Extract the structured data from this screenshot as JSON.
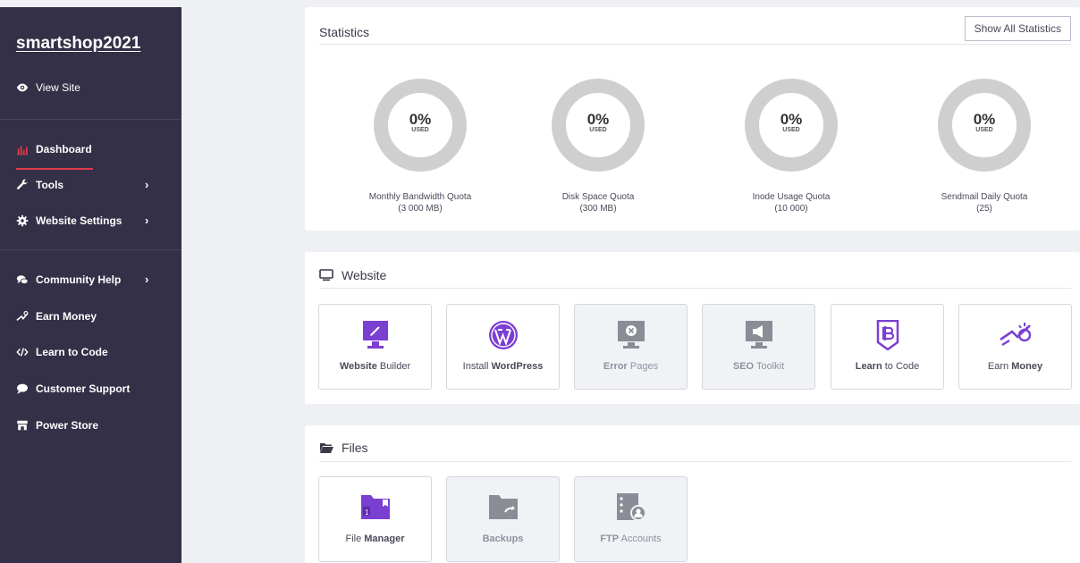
{
  "sidebar": {
    "brand": "smartshop2021",
    "view_site": "View Site",
    "items": [
      {
        "label": "Dashboard"
      },
      {
        "label": "Tools"
      },
      {
        "label": "Website Settings"
      },
      {
        "label": "Community Help"
      },
      {
        "label": "Earn Money"
      },
      {
        "label": "Learn to Code"
      },
      {
        "label": "Customer Support"
      },
      {
        "label": "Power Store"
      }
    ]
  },
  "statistics": {
    "title": "Statistics",
    "show_all": "Show All Statistics",
    "used_text": "USED",
    "items": [
      {
        "value": "0%",
        "label": "Monthly Bandwidth Quota",
        "sub": "(3 000 MB)"
      },
      {
        "value": "0%",
        "label": "Disk Space Quota",
        "sub": "(300 MB)"
      },
      {
        "value": "0%",
        "label": "Inode Usage Quota",
        "sub": "(10 000)"
      },
      {
        "value": "0%",
        "label": "Sendmail Daily Quota",
        "sub": "(25)"
      }
    ]
  },
  "website": {
    "title": "Website",
    "tiles": [
      {
        "bold": "Website",
        "rest": " Builder",
        "icon": "website-builder-icon"
      },
      {
        "pre": "Install ",
        "bold": "WordPress",
        "icon": "wordpress-icon"
      },
      {
        "bold": "Error",
        "rest": " Pages",
        "icon": "error-pages-icon"
      },
      {
        "bold": "SEO",
        "rest": " Toolkit",
        "icon": "seo-toolkit-icon"
      },
      {
        "bold": "Learn",
        "rest": " to Code",
        "icon": "learn-to-code-icon"
      },
      {
        "pre": "Earn ",
        "bold": "Money",
        "icon": "earn-money-icon"
      }
    ]
  },
  "files": {
    "title": "Files",
    "tiles": [
      {
        "pre": "File ",
        "bold": "Manager",
        "icon": "file-manager-icon"
      },
      {
        "bold": "Backups",
        "icon": "backups-icon"
      },
      {
        "bold": "FTP",
        "rest": " Accounts",
        "icon": "ftp-accounts-icon"
      }
    ]
  },
  "colors": {
    "sidebar_bg": "#343047",
    "accent_purple": "#7b3fd1",
    "active_underline": "#e0394b",
    "ring_gray": "#cfcfcf"
  }
}
